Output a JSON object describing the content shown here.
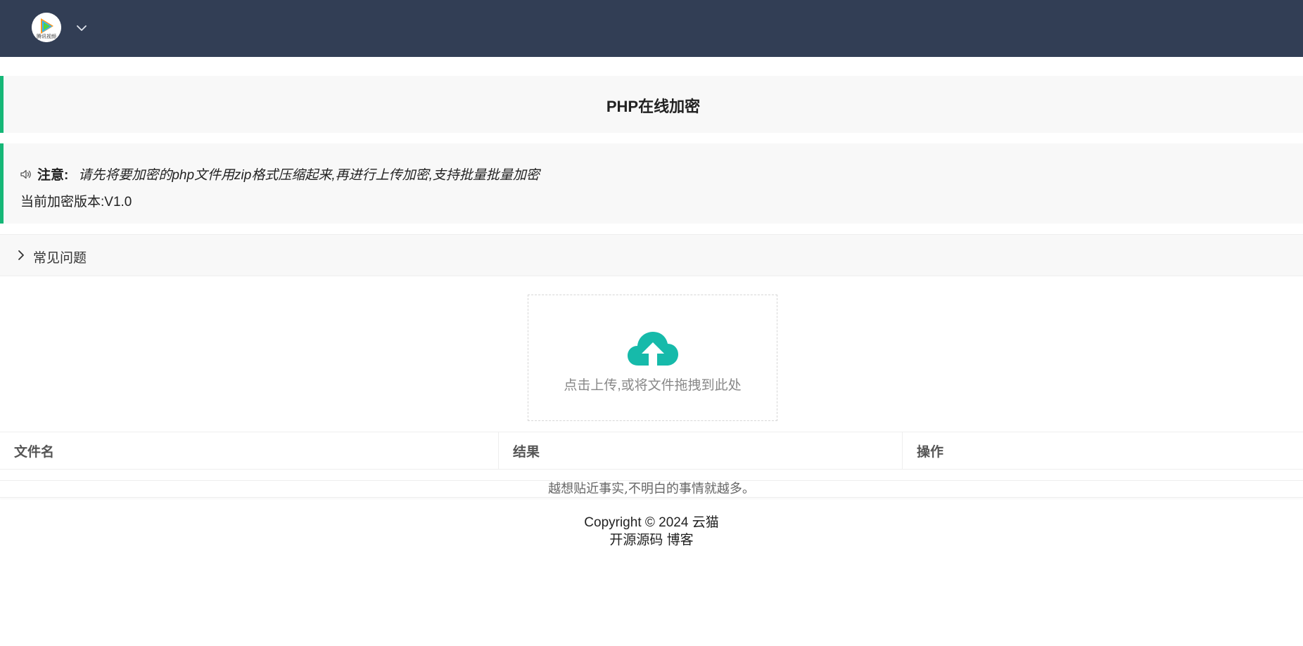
{
  "header": {
    "logo_text": "腾讯视频",
    "logo_icon": "play-logo-icon",
    "menu_icon": "chevron-down-icon"
  },
  "page": {
    "title": "PHP在线加密"
  },
  "notice": {
    "icon": "speaker-icon",
    "label": "注意:",
    "message": "请先将要加密的php文件用zip格式压缩起来,再进行上传加密,支持批量批量加密",
    "version_text": "当前加密版本:V1.0"
  },
  "faq": {
    "label": "常见问题",
    "icon": "chevron-right-icon"
  },
  "upload": {
    "icon": "cloud-upload-icon",
    "text": "点击上传,或将文件拖拽到此处"
  },
  "table": {
    "columns": [
      "文件名",
      "结果",
      "操作"
    ]
  },
  "quote": "越想贴近事实,不明白的事情就越多。",
  "footer": {
    "copyright": "Copyright © 2024 云猫",
    "links": [
      "开源源码",
      "博客"
    ]
  },
  "colors": {
    "header_bg": "#323e55",
    "accent": "#16b777",
    "upload_icon": "#16baaa"
  }
}
